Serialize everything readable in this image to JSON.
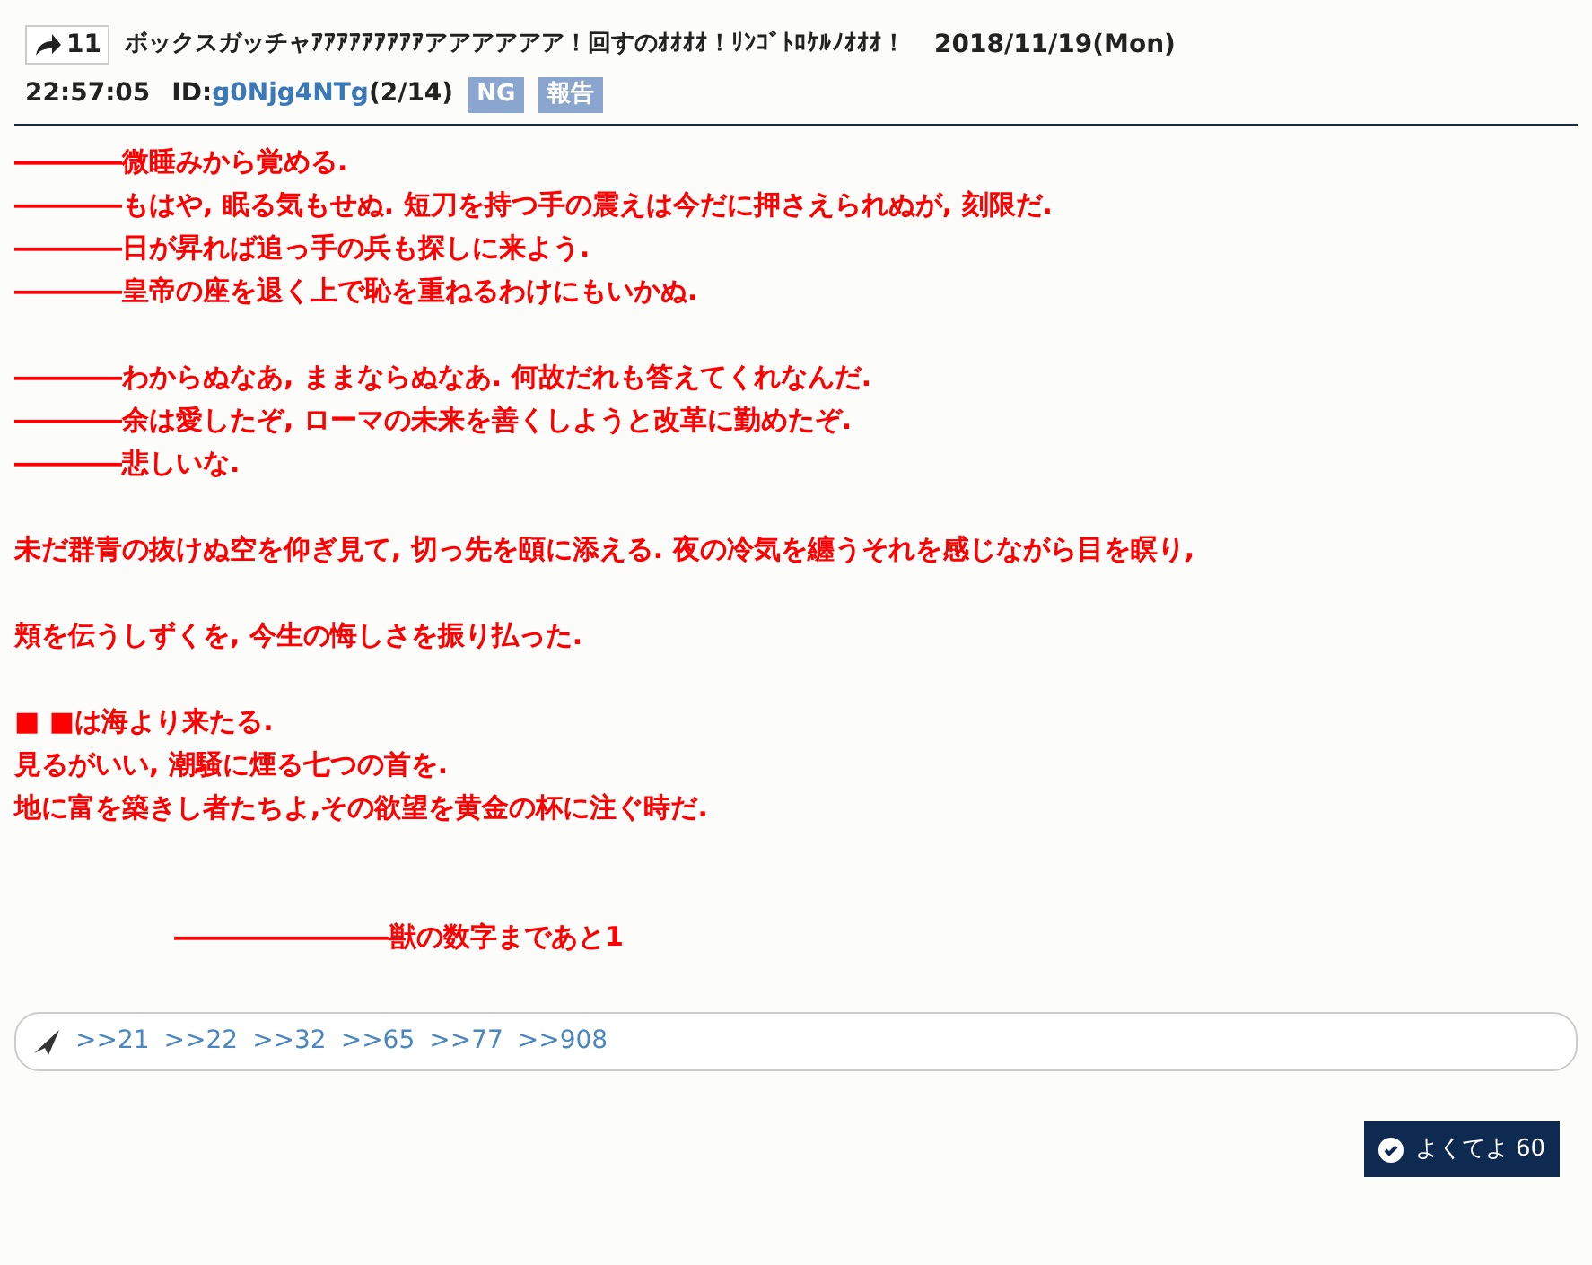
{
  "post": {
    "reply_count": "11",
    "title": "ボックスガッチャｱｱｱｱｱｱｱｱｱアアアアアア！回すのｵｵｵｵ！ﾘﾝｺﾞﾄﾛｹﾙﾉｵｵｵ！",
    "date": "2018/11/19(Mon)",
    "time": "22:57:05",
    "id_label": "ID:",
    "id": "g0Njg4NTg",
    "id_count": "(2/14)",
    "buttons": [
      "NG",
      "報告"
    ]
  },
  "body": [
    {
      "indent": false,
      "lines": [
        "――――微睡みから覚める.",
        "――――もはや, 眠る気もせぬ. 短刀を持つ手の震えは今だに押さえられぬが, 刻限だ.",
        "――――日が昇れば追っ手の兵も探しに来よう.",
        "――――皇帝の座を退く上で恥を重ねるわけにもいかぬ."
      ]
    },
    {
      "indent": false,
      "lines": [
        "――――わからぬなあ, ままならぬなあ. 何故だれも答えてくれなんだ.",
        "――――余は愛したぞ, ローマの未来を善くしようと改革に勤めたぞ.",
        "――――悲しいな."
      ]
    },
    {
      "indent": false,
      "lines": [
        "未だ群青の抜けぬ空を仰ぎ見て, 切っ先を頤に添える. 夜の冷気を纏うそれを感じながら目を瞑り,"
      ]
    },
    {
      "indent": false,
      "lines": [
        "頬を伝うしずくを, 今生の悔しさを振り払った."
      ]
    },
    {
      "indent": false,
      "lines": [
        "■ ■は海より来たる.",
        "見るがいい, 潮騒に煙る七つの首を.",
        "地に富を築きし者たちよ,その欲望を黄金の杯に注ぐ時だ."
      ]
    },
    {
      "indent": true,
      "lines": [
        "――――――――獣の数字まであと1"
      ]
    }
  ],
  "replies": [
    ">>21",
    ">>22",
    ">>32",
    ">>65",
    ">>77",
    ">>908"
  ],
  "like": {
    "label": "よくてよ",
    "count": "60"
  }
}
